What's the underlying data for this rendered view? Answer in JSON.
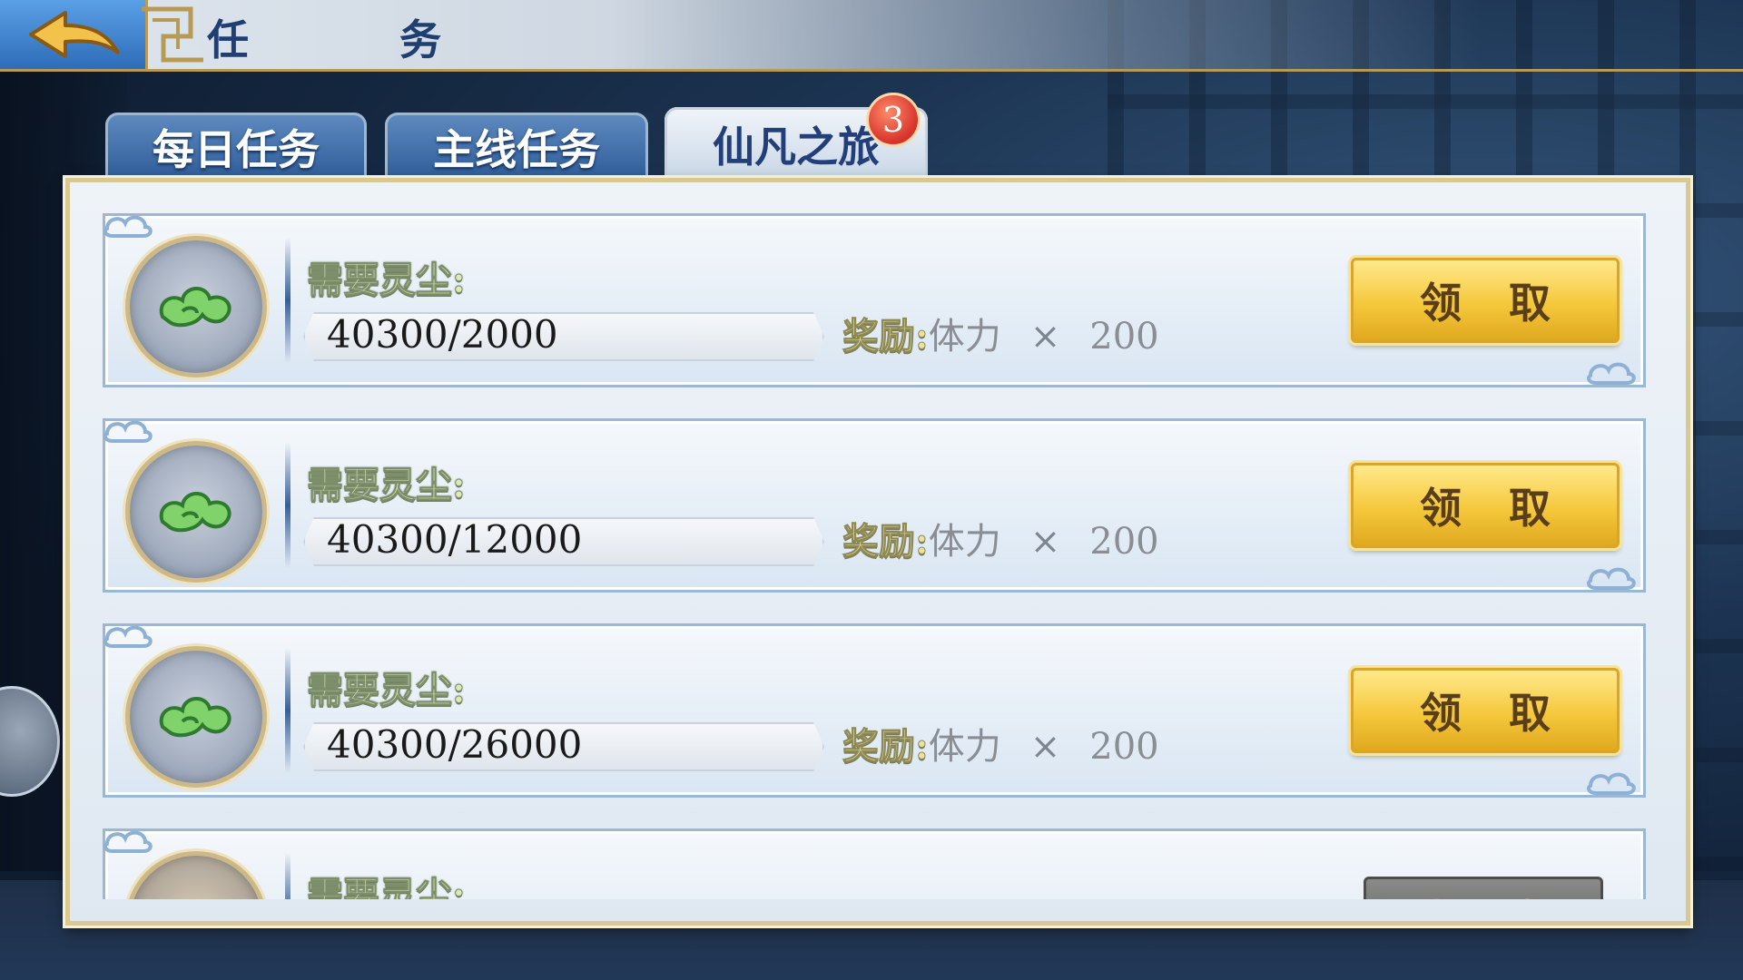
{
  "header": {
    "title": "任　务"
  },
  "tabs": [
    {
      "label": "每日任务",
      "active": false
    },
    {
      "label": "主线任务",
      "active": false
    },
    {
      "label": "仙凡之旅",
      "active": true,
      "badge": "3"
    }
  ],
  "tasks": [
    {
      "label": "需要灵尘:",
      "progress": "40300/2000",
      "reward_label": "奖励:",
      "reward_item": "体力",
      "times": "×",
      "reward_qty": "200",
      "button": "领取",
      "status": "claimable",
      "icon": "green-cloud-icon"
    },
    {
      "label": "需要灵尘:",
      "progress": "40300/12000",
      "reward_label": "奖励:",
      "reward_item": "体力",
      "times": "×",
      "reward_qty": "200",
      "button": "领取",
      "status": "claimable",
      "icon": "green-cloud-icon"
    },
    {
      "label": "需要灵尘:",
      "progress": "40300/26000",
      "reward_label": "奖励:",
      "reward_item": "体力",
      "times": "×",
      "reward_qty": "200",
      "button": "领取",
      "status": "claimable",
      "icon": "green-cloud-icon"
    },
    {
      "label": "需要灵尘:",
      "button": "未达成",
      "status": "incomplete",
      "icon": "gold-cloud-icon"
    }
  ],
  "colors": {
    "claim_button": "#f5c83b",
    "tab_inactive": "#2d5b98",
    "tab_active": "#dbe5ef",
    "badge": "#d6322a"
  }
}
